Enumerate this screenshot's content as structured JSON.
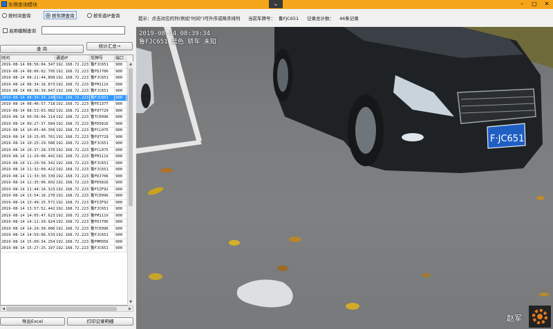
{
  "window": {
    "title": "车牌查询模块"
  },
  "filters": {
    "radio_time": "按时间查询",
    "radio_plate": "按车牌查询",
    "radio_ip": "按车道IP查询",
    "checkbox_fuzzy": "启用模糊查询",
    "fuzzy_value": "",
    "stats_button": "统计汇总→",
    "query_button": "查  询"
  },
  "table": {
    "columns": [
      "时间",
      "通道IP",
      "车牌号",
      "端口"
    ],
    "selected_index": 5,
    "rows": [
      [
        "2019-08-14 08:56:04.347",
        "192.168.72.223",
        "鲁FJC651",
        "900"
      ],
      [
        "2019-08-14 08:06:02.795",
        "192.168.72.223",
        "鲁FDJ706",
        "900"
      ],
      [
        "2019-08-14 08:21:44.899",
        "192.168.72.223",
        "鲁FJC651",
        "900"
      ],
      [
        "2019-08-14 08:34:16.873",
        "192.168.72.223",
        "鲁FM111X",
        "900"
      ],
      [
        "2019-08-14 08:36:39.047",
        "192.168.72.223",
        "鲁FJC651",
        "900"
      ],
      [
        "2019-08-14 08:39:34.240",
        "192.168.72.223",
        "鲁FJC651",
        "900"
      ],
      [
        "2019-08-14 08:46:57.718",
        "192.168.72.223",
        "鲁FE137T",
        "900"
      ],
      [
        "2019-08-14 08:53:03.082",
        "192.168.72.223",
        "鲁FQT729",
        "900"
      ],
      [
        "2019-08-14 09:56:04.114",
        "192.168.72.223",
        "鲁TCE096",
        "900"
      ],
      [
        "2019-08-14 09:27:37.584",
        "192.168.72.223",
        "鲁FD5816",
        "900"
      ],
      [
        "2019-08-14 10:05:40.356",
        "192.168.72.223",
        "鲁FCL075",
        "900"
      ],
      [
        "2019-08-14 10:15:05.761",
        "192.168.72.223",
        "鲁FQT729",
        "900"
      ],
      [
        "2019-08-14 10:25:29.586",
        "192.168.72.223",
        "鲁FJC651",
        "900"
      ],
      [
        "2019-08-14 10:37:28.370",
        "192.168.72.223",
        "鲁FCL075",
        "900"
      ],
      [
        "2019-08-14 11:29:06.441",
        "192.168.72.223",
        "鲁FM111X",
        "900"
      ],
      [
        "2019-08-14 11:29:56.342",
        "192.168.72.223",
        "鲁FJC651",
        "900"
      ],
      [
        "2019-08-14 11:32:00.422",
        "192.168.72.223",
        "鲁FJC651",
        "900"
      ],
      [
        "2019-08-14 11:33:30.339",
        "192.168.72.223",
        "鲁FDJ706",
        "900"
      ],
      [
        "2019-08-14 11:35:06.602",
        "192.168.72.223",
        "鲁FD5816",
        "900"
      ],
      [
        "2019-08-14 11:44:16.323",
        "192.168.72.223",
        "鲁FIZF92",
        "900"
      ],
      [
        "2019-08-14 13:54:16.270",
        "192.168.72.223",
        "鲁TCE096",
        "900"
      ],
      [
        "2019-08-14 13:49:15.571",
        "192.168.72.223",
        "鲁FIZF92",
        "900"
      ],
      [
        "2019-08-14 13:57:52.442",
        "192.168.72.223",
        "鲁FJC651",
        "900"
      ],
      [
        "2019-08-14 14:05:47.623",
        "192.168.72.223",
        "鲁FM111X",
        "900"
      ],
      [
        "2019-08-14 14:11:39.924",
        "192.168.72.223",
        "鲁FDJ706",
        "900"
      ],
      [
        "2019-08-14 14:29:30.006",
        "192.168.72.223",
        "鲁TCE096",
        "900"
      ],
      [
        "2019-08-14 14:59:06.533",
        "192.168.72.223",
        "鲁FJC651",
        "900"
      ],
      [
        "2019-08-14 15:00:34.254",
        "192.168.72.223",
        "鲁FMM356",
        "900"
      ],
      [
        "2019-08-14 15:27:25.197",
        "192.168.72.223",
        "鲁FJC651",
        "900"
      ]
    ]
  },
  "actions": {
    "export_button": "导出Excel",
    "print_button": "打印记录明细"
  },
  "info": {
    "hint": "提示：点击对应的列(例如\"时间\")可升序或降序排列",
    "plate_label": "当前车牌号：",
    "plate_value": "鲁FJC651",
    "total_label": "记录总计数：",
    "total_value": "46条记录"
  },
  "photo": {
    "overlay_line1": "2019-08-14 08:39:34",
    "overlay_line2": "鲁FJC651 蓝色 轿车 未知",
    "plate_text": "F·JC651",
    "watermark": "赵军"
  },
  "colors": {
    "titlebar": "#f4a51a",
    "selected_row": "#3399ff",
    "plate_blue": "#1f5fc4"
  }
}
